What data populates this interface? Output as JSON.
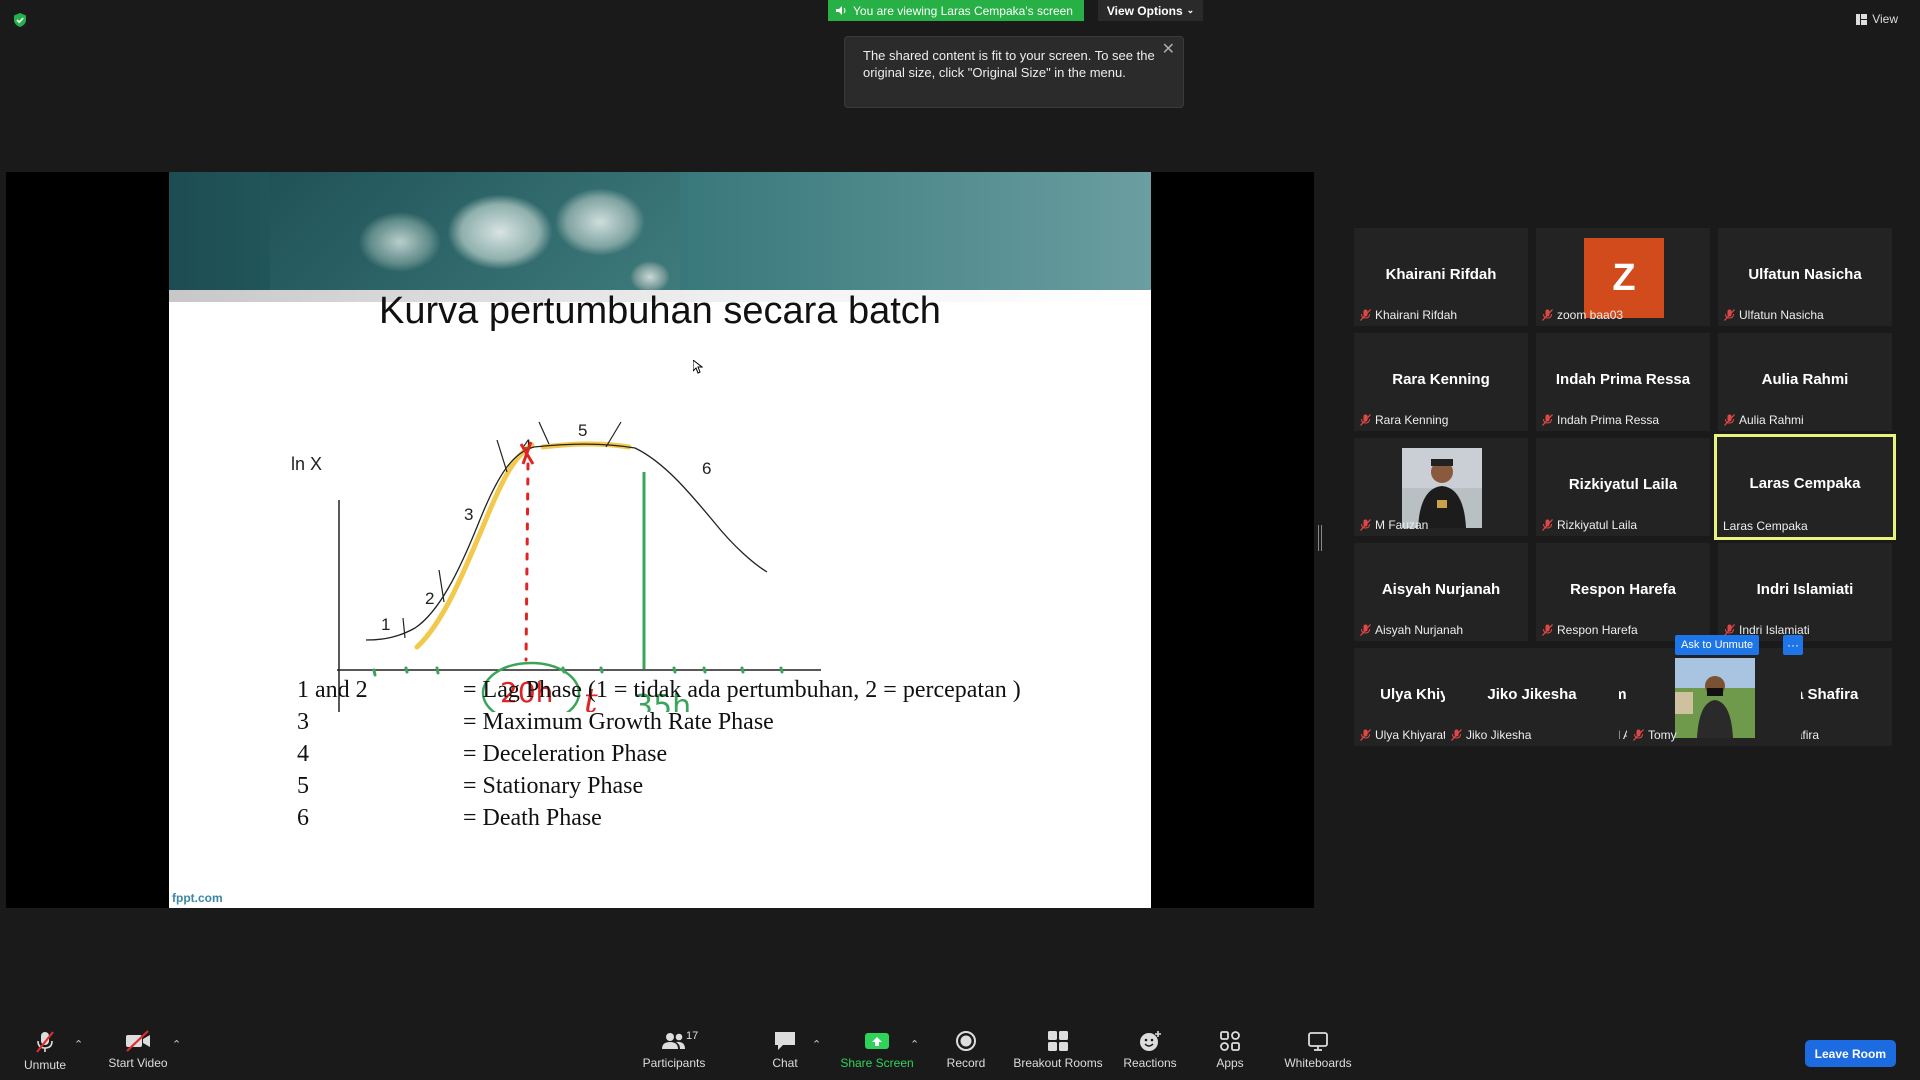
{
  "top": {
    "viewing_banner": "You are viewing Laras Cempaka's screen",
    "view_options": "View Options",
    "view_label": "View",
    "tooltip": "The shared content is fit to your screen. To see the original size, click \"Original Size\" in the menu."
  },
  "slide": {
    "title": "Kurva pertumbuhan secara batch",
    "y_axis_label": "ln X",
    "phase_labels": [
      "1",
      "2",
      "3",
      "4",
      "5",
      "6"
    ],
    "annotation_1": "20h",
    "annotation_t": "t",
    "annotation_2": "35h",
    "legend": [
      {
        "num": "1 and 2",
        "desc": "= Lag Phase (1 = tidak ada pertumbuhan, 2 = percepatan )"
      },
      {
        "num": "3",
        "desc": "= Maximum Growth Rate Phase"
      },
      {
        "num": "4",
        "desc": "= Deceleration Phase"
      },
      {
        "num": "5",
        "desc": "= Stationary Phase"
      },
      {
        "num": "6",
        "desc": "= Death Phase"
      }
    ],
    "footer": "fppt.com"
  },
  "gallery": {
    "tiles": [
      {
        "center": "Khairani Rifdah",
        "label": "Khairani Rifdah"
      },
      {
        "center": "Z",
        "label": "zoom baa03"
      },
      {
        "center": "Ulfatun Nasicha",
        "label": "Ulfatun Nasicha"
      },
      {
        "center": "Rara Kenning",
        "label": "Rara Kenning"
      },
      {
        "center": "Indah Prima Ressa",
        "label": "Indah Prima Ressa"
      },
      {
        "center": "Aulia Rahmi",
        "label": "Aulia Rahmi"
      },
      {
        "center": "",
        "label": "M Fauzan"
      },
      {
        "center": "Rizkiyatul Laila",
        "label": "Rizkiyatul Laila"
      },
      {
        "center": "Laras Cempaka",
        "label": "Laras Cempaka"
      },
      {
        "center": "Aisyah Nurjanah",
        "label": "Aisyah Nurjanah"
      },
      {
        "center": "Respon Harefa",
        "label": "Respon Harefa"
      },
      {
        "center": "Indri Islamiati",
        "label": "Indri Islamiati"
      },
      {
        "center": "Ulya Khiyaratul...",
        "label": "Ulya Khiyaratul Mar'ah"
      },
      {
        "center": "Muhammed Ars...",
        "label": "Muhammed Arsy E P"
      },
      {
        "center": "Iqmalia Shafira",
        "label": "Iqmalia Shafira"
      },
      {
        "center": "Jiko Jikesha",
        "label": "Jiko Jikesha"
      },
      {
        "center": "",
        "label": "Tomy"
      }
    ],
    "ask_to_unmute": "Ask to Unmute",
    "more": "···"
  },
  "toolbar": {
    "unmute": "Unmute",
    "start_video": "Start Video",
    "participants": "Participants",
    "participant_count": "17",
    "chat": "Chat",
    "share_screen": "Share Screen",
    "record": "Record",
    "breakout_rooms": "Breakout Rooms",
    "reactions": "Reactions",
    "apps": "Apps",
    "whiteboards": "Whiteboards",
    "leave_room": "Leave Room"
  },
  "colors": {
    "banner_green": "#26b045",
    "share_green": "#2fd35a",
    "active_border": "#e9f27c",
    "leave_blue": "#1d6be0",
    "avatar_orange": "#d24b1d"
  }
}
